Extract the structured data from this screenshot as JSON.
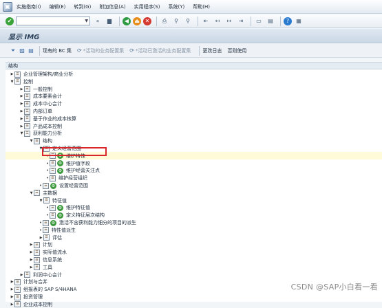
{
  "menu": {
    "app_icon": "sap-window-icon",
    "items": [
      "实施指南(I)",
      "编辑(E)",
      "转到(G)",
      "附加信息(A)",
      "实用程序(S)",
      "系统(Y)",
      "帮助(H)"
    ]
  },
  "toolbar": {
    "command_value": "",
    "save_icon": "save-icon"
  },
  "title": {
    "text": "显示 IMG"
  },
  "app_toolbar": {
    "bc_sets": "现有的 BC 集",
    "activated_bc": "*活动的业务配置集",
    "activated_bc2": "*活动已激活的业务配置集",
    "change_log": "更改日志",
    "release": "否则使用"
  },
  "tree": {
    "header": "结构",
    "rows": [
      {
        "label": "企业管理架构/商业分析",
        "level": 1,
        "toggle": "collapsed"
      },
      {
        "label": "控制",
        "level": 1,
        "toggle": "expanded"
      },
      {
        "label": "一般控制",
        "level": 2,
        "toggle": "collapsed"
      },
      {
        "label": "成本要素会计",
        "level": 2,
        "toggle": "collapsed"
      },
      {
        "label": "成本中心会计",
        "level": 2,
        "toggle": "collapsed"
      },
      {
        "label": "内部订单",
        "level": 2,
        "toggle": "collapsed"
      },
      {
        "label": "基于作业的成本核算",
        "level": 2,
        "toggle": "collapsed"
      },
      {
        "label": "产品成本控制",
        "level": 2,
        "toggle": "collapsed"
      },
      {
        "label": "获利能力分析",
        "level": 2,
        "toggle": "expanded"
      },
      {
        "label": "结构",
        "level": 3,
        "toggle": "expanded"
      },
      {
        "label": "定义经营范围",
        "level": 4,
        "toggle": "expanded"
      },
      {
        "label": "维护特性",
        "level": 5,
        "toggle": "leaf",
        "gear": true,
        "highlighted": true
      },
      {
        "label": "维护值字段",
        "level": 5,
        "toggle": "leaf",
        "gear": true
      },
      {
        "label": "维护经营关注点",
        "level": 5,
        "toggle": "leaf",
        "gear": true
      },
      {
        "label": "维护经营组织",
        "level": 5,
        "toggle": "leaf"
      },
      {
        "label": "设置经营范围",
        "level": 4,
        "toggle": "leaf",
        "gear": true
      },
      {
        "label": "主数据",
        "level": 3,
        "toggle": "expanded"
      },
      {
        "label": "特征值",
        "level": 4,
        "toggle": "expanded"
      },
      {
        "label": "维护特征值",
        "level": 5,
        "toggle": "leaf",
        "gear": true
      },
      {
        "label": "定义特征层次结构",
        "level": 5,
        "toggle": "leaf",
        "gear": true
      },
      {
        "label": "激活不含获利能力细分的项目的派生",
        "level": 4,
        "toggle": "leaf",
        "gear": true
      },
      {
        "label": "特性值派生",
        "level": 4,
        "toggle": "leaf"
      },
      {
        "label": "评估",
        "level": 4,
        "toggle": "collapsed"
      },
      {
        "label": "计划",
        "level": 3,
        "toggle": "collapsed"
      },
      {
        "label": "实际值流水",
        "level": 3,
        "toggle": "collapsed"
      },
      {
        "label": "信息系统",
        "level": 3,
        "toggle": "collapsed"
      },
      {
        "label": "工具",
        "level": 3,
        "toggle": "collapsed"
      },
      {
        "label": "利润中心会计",
        "level": 2,
        "toggle": "collapsed"
      },
      {
        "label": "计划与合并",
        "level": 1,
        "toggle": "collapsed"
      },
      {
        "label": "组报表的 SAP S/4HANA",
        "level": 1,
        "toggle": "collapsed"
      },
      {
        "label": "投资管理",
        "level": 1,
        "toggle": "collapsed"
      },
      {
        "label": "企业成本控制",
        "level": 1,
        "toggle": "collapsed"
      }
    ]
  },
  "watermark": "CSDN @SAP小白看一看"
}
